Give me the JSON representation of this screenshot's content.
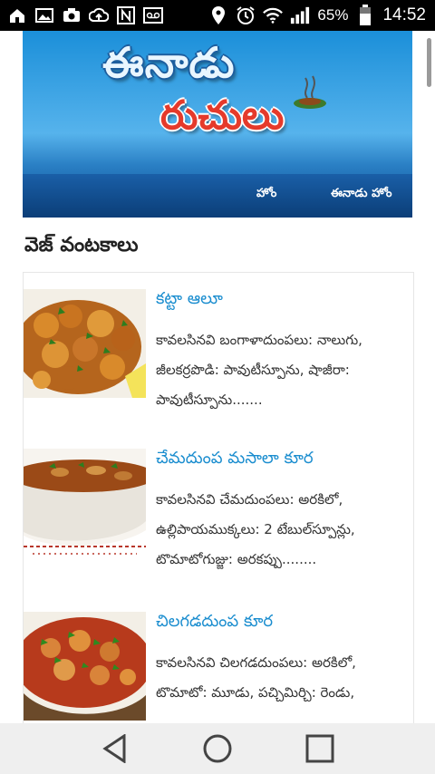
{
  "status_bar": {
    "battery_text": "65%",
    "time": "14:52",
    "icons_left": [
      "home-icon",
      "image-icon",
      "camera-icon",
      "cloud-upload-icon",
      "nfc-icon",
      "voicemail-icon"
    ],
    "icons_right": [
      "location-icon",
      "alarm-icon",
      "wifi-icon",
      "signal-icon",
      "battery-icon"
    ]
  },
  "header": {
    "logo_top": "ఈనాడు",
    "logo_bottom": "రుచులు",
    "nav": [
      "హోం",
      "ఈనాడు హోం"
    ]
  },
  "section": {
    "title": "వెజ్ వంటకాలు"
  },
  "recipes": [
    {
      "title": "కట్టా ఆలూ",
      "description": "కావలసినవి బంగాళాదుంపలు: నాలుగు, జీలకర్రపొడి: పావుటీస్పూను, షాజీరా: పావుటీస్పూను.......",
      "thumb": "spiced-potato-dish-image"
    },
    {
      "title": "చేమదుంప మసాలా కూర",
      "description": "కావలసినవి చేమదుంపలు: అరకిలో, ఉల్లిపాయముక్కలు: 2 టేబుల్‌స్పూన్లు, టొమాటోగుజ్జు: అరకప్పు........",
      "thumb": "colocasia-masala-bowl-image"
    },
    {
      "title": "చిలగడదుంప కూర",
      "description": "కావలసినవి చిలగడదుంపలు: అరకిలో, టొమాటో: మూడు, పచ్చిమిర్చి: రెండు,",
      "thumb": "sweet-potato-curry-image"
    }
  ],
  "navigation_bar": {
    "buttons": [
      "back-icon",
      "home-circle-icon",
      "recents-icon"
    ]
  },
  "colors": {
    "title_blue": "#1a8dcf",
    "banner_blue": "#1b8fd9",
    "logo_red": "#e53a2b"
  }
}
